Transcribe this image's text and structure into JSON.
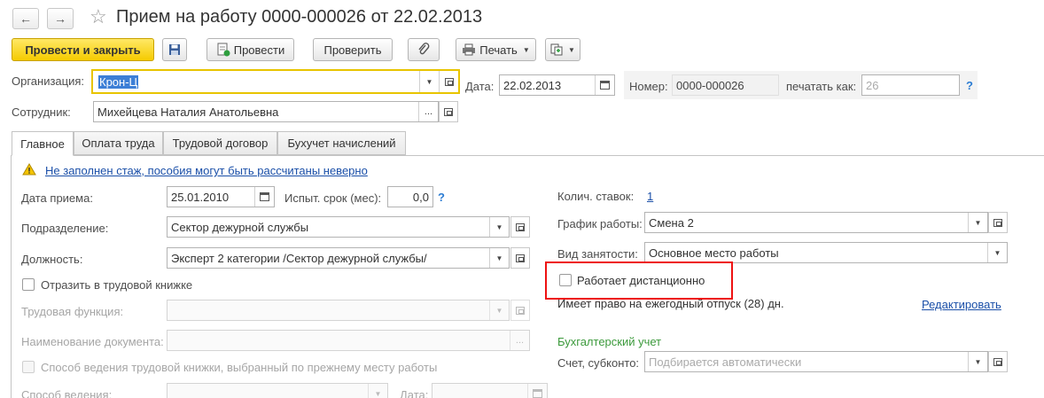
{
  "window": {
    "title": "Прием на работу 0000-000026 от 22.02.2013",
    "back_icon": "←",
    "forward_icon": "→",
    "favorite_icon": "☆"
  },
  "toolbar": {
    "post_close": "Провести и закрыть",
    "post": "Провести",
    "check": "Проверить",
    "print": "Печать"
  },
  "header": {
    "org_label": "Организация:",
    "org_value": "Крон-Ц",
    "date_label": "Дата:",
    "date_value": "22.02.2013",
    "number_label": "Номер:",
    "number_value": "0000-000026",
    "print_as_label": "печатать как:",
    "print_as_placeholder": "26",
    "help": "?",
    "employee_label": "Сотрудник:",
    "employee_value": "Михейцева Наталия Анатольевна"
  },
  "tabs": [
    "Главное",
    "Оплата труда",
    "Трудовой договор",
    "Бухучет начислений"
  ],
  "warning": "Не заполнен стаж, пособия могут быть рассчитаны неверно",
  "left": {
    "hire_date_label": "Дата приема:",
    "hire_date_value": "25.01.2010",
    "probation_label": "Испыт. срок (мес):",
    "probation_value": "0,0",
    "dept_label": "Подразделение:",
    "dept_value": "Сектор дежурной службы",
    "position_label": "Должность:",
    "position_value": "Эксперт 2 категории /Сектор дежурной службы/",
    "workbook_label": "Отразить в трудовой книжке",
    "labor_function_label": "Трудовая функция:",
    "doc_name_label": "Наименование документа:",
    "method_prev_label": "Способ ведения трудовой книжки, выбранный по прежнему месту работы",
    "method_label": "Способ ведения:",
    "date2_label": "Дата:"
  },
  "right": {
    "rates_label": "Колич. ставок:",
    "rates_value": "1",
    "schedule_label": "График работы:",
    "schedule_value": "Смена 2",
    "employment_label": "Вид занятости:",
    "employment_value": "Основное место работы",
    "remote_label": "Работает дистанционно",
    "vacation_text": "Имеет право на ежегодный отпуск (28) дн.",
    "edit_link": "Редактировать",
    "accounting_title": "Бухгалтерский учет",
    "account_label": "Счет, субконто:",
    "account_placeholder": "Подбирается автоматически"
  }
}
